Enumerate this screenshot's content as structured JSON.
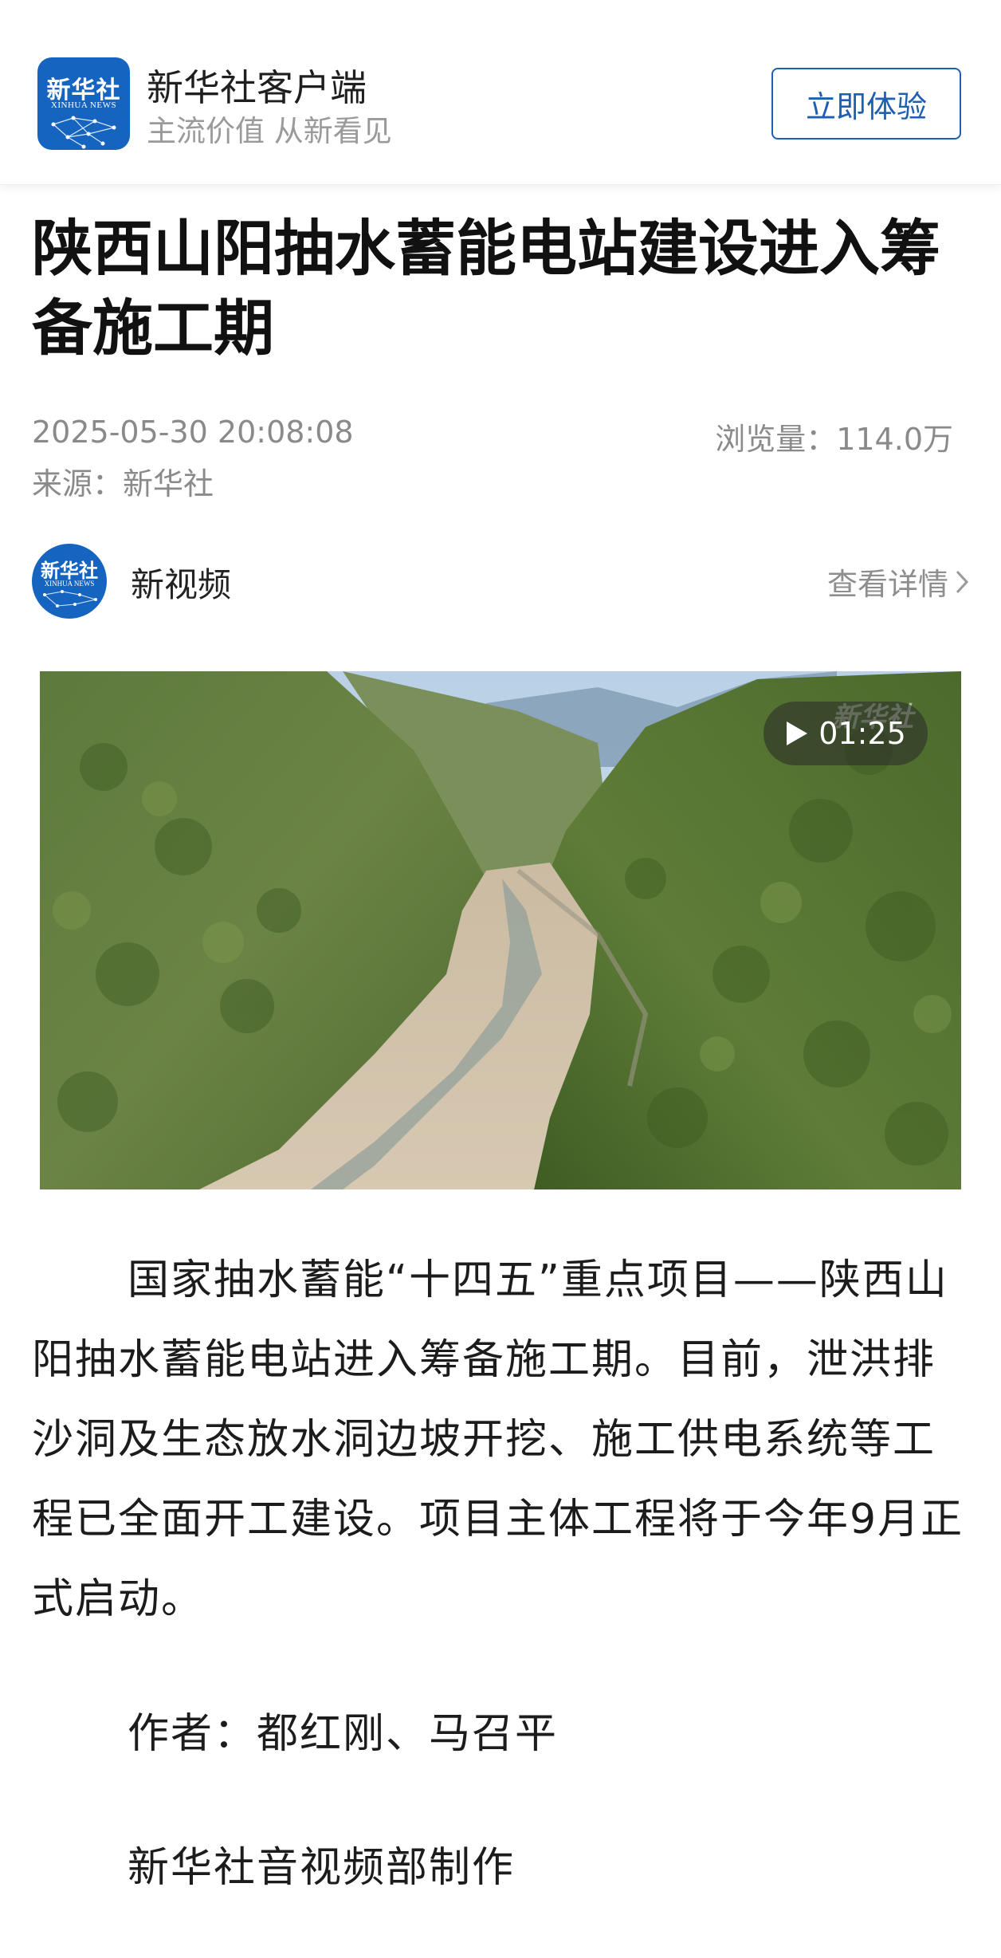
{
  "header": {
    "app_name": "新华社客户端",
    "slogan": "主流价值 从新看见",
    "logo_text_cn": "新华社",
    "logo_text_en": "XINHUA NEWS",
    "try_button_label": "立即体验"
  },
  "article": {
    "title": "陕西山阳抽水蓄能电站建设进入筹备施工期",
    "datetime": "2025-05-30 20:08:08",
    "views": "浏览量：114.0万",
    "source": "来源：新华社"
  },
  "channel": {
    "avatar_text_cn": "新华社",
    "avatar_text_en": "XINHUA NEWS",
    "name": "新视频",
    "details_label": "查看详情"
  },
  "video": {
    "duration": "01:25",
    "watermark": "新华社"
  },
  "body": {
    "paragraph": "国家抽水蓄能“十四五”重点项目——陕西山阳抽水蓄能电站进入筹备施工期。目前，泄洪排沙洞及生态放水洞边坡开挖、施工供电系统等工程已全面开工建设。项目主体工程将于今年9月正式启动。",
    "author": "作者：都红刚、马召平",
    "producer": "新华社音视频部制作"
  },
  "colors": {
    "brand_blue": "#1565c0",
    "button_blue": "#1e5fb3",
    "meta_gray": "#8a8a8a"
  }
}
